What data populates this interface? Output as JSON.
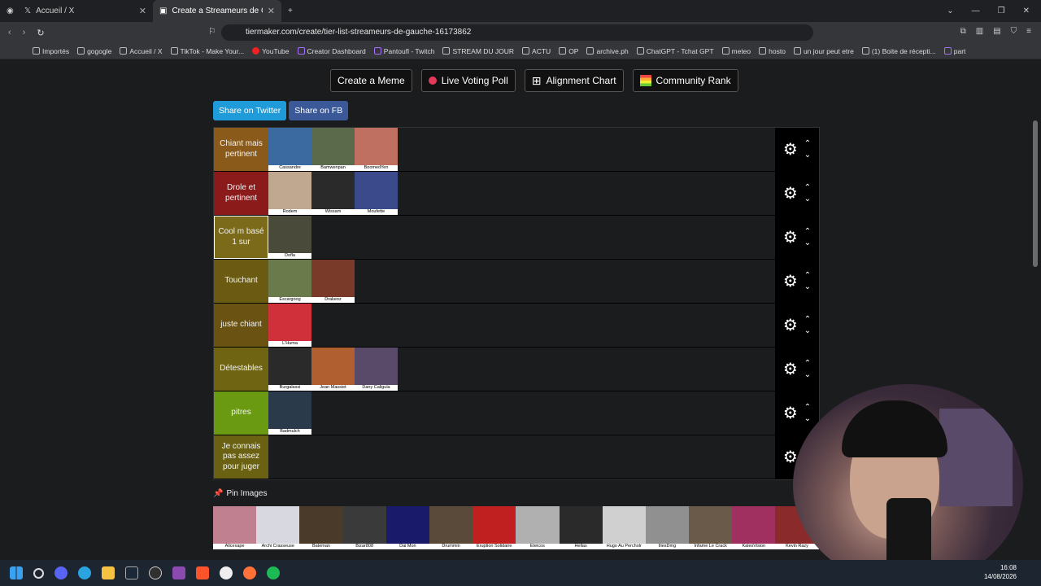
{
  "browser": {
    "tabs": [
      {
        "label": "Accueil / X",
        "active": false
      },
      {
        "label": "Create a Streameurs de Gauche",
        "active": true
      }
    ],
    "url": "tiermaker.com/create/tier-list-streameurs-de-gauche-16173862",
    "bookmarks": [
      "Importés",
      "gogogle",
      "Accueil / X",
      "TikTok - Make Your...",
      "YouTube",
      "Creator Dashboard",
      "Pantoufl - Twitch",
      "STREAM DU JOUR",
      "ACTU",
      "OP",
      "archive.ph",
      "ChatGPT - Tchat GPT",
      "meteo",
      "hosto",
      "un jour peut etre",
      "(1) Boite de récepti...",
      "part"
    ]
  },
  "toolbar": {
    "create_meme": "Create a Meme",
    "live_poll": "Live Voting Poll",
    "alignment": "Alignment Chart",
    "community": "Community Rank",
    "share_twitter": "Share on Twitter",
    "share_fb": "Share on FB"
  },
  "tiers": [
    {
      "label": "Chiant mais pertinent",
      "color": "#8a5a1a",
      "items": [
        {
          "name": "Cassandre",
          "color": "#3a6aa0"
        },
        {
          "name": "Bamwenpan",
          "color": "#5a6a4a"
        },
        {
          "name": "BoomedYen",
          "color": "#c07060"
        }
      ]
    },
    {
      "label": "Drole et pertinent",
      "color": "#8b1a1a",
      "items": [
        {
          "name": "Rodem",
          "color": "#c0a890"
        },
        {
          "name": "Wissam",
          "color": "#2a2a2a"
        },
        {
          "name": "Moufette",
          "color": "#3a4a8a"
        }
      ]
    },
    {
      "label": "Cool m basé 1 sur",
      "color": "#7a6a1a",
      "items": [
        {
          "name": "Dofla",
          "color": "#4a4a3a"
        }
      ]
    },
    {
      "label": "Touchant",
      "color": "#6a5a12",
      "items": [
        {
          "name": "Escargoog",
          "color": "#6a7a4a"
        },
        {
          "name": "Drakeoz",
          "color": "#7a3a2a"
        }
      ]
    },
    {
      "label": "juste chiant",
      "color": "#6a5212",
      "items": [
        {
          "name": "L'Huma",
          "color": "#d0303a"
        }
      ]
    },
    {
      "label": "Détestables",
      "color": "#6e6412",
      "items": [
        {
          "name": "Burgalassi",
          "color": "#2a2a2a"
        },
        {
          "name": "Jean Massiet",
          "color": "#b06030"
        },
        {
          "name": "Dany Caligula",
          "color": "#5a4a6a"
        }
      ]
    },
    {
      "label": "pitres",
      "color": "#6a9a12",
      "items": [
        {
          "name": "Badmulch",
          "color": "#2a3a4a"
        }
      ]
    },
    {
      "label": "Je connais pas assez pour juger",
      "color": "#6a6212",
      "items": []
    }
  ],
  "pin_label": "Pin Images",
  "pool": [
    {
      "name": "Alicexape",
      "color": "#c08090"
    },
    {
      "name": "Archi Crasseuse",
      "color": "#d8d8e0"
    },
    {
      "name": "Bateman",
      "color": "#4a3a2a"
    },
    {
      "name": "Bizar808",
      "color": "#3a3a3a"
    },
    {
      "name": "Dai Mon",
      "color": "#1a1a6a"
    },
    {
      "name": "Drummin",
      "color": "#5a4a3a"
    },
    {
      "name": "Eruption Solidaire",
      "color": "#c02020"
    },
    {
      "name": "Eteicos",
      "color": "#b0b0b0"
    },
    {
      "name": "Hellas",
      "color": "#2a2a2a"
    },
    {
      "name": "Hugo Au Percholr",
      "color": "#d0d0d0"
    },
    {
      "name": "IliesDmg",
      "color": "#909090"
    },
    {
      "name": "Infame Le Crack",
      "color": "#6a5a4a"
    },
    {
      "name": "KalesVision",
      "color": "#a03060"
    },
    {
      "name": "Kevin Razy",
      "color": "#8a2a2a"
    }
  ],
  "taskbar": {
    "time": "16:08",
    "date": "14/08/2026"
  },
  "colors": {
    "twitter": "#1da1f2",
    "fb": "#3b5998"
  }
}
